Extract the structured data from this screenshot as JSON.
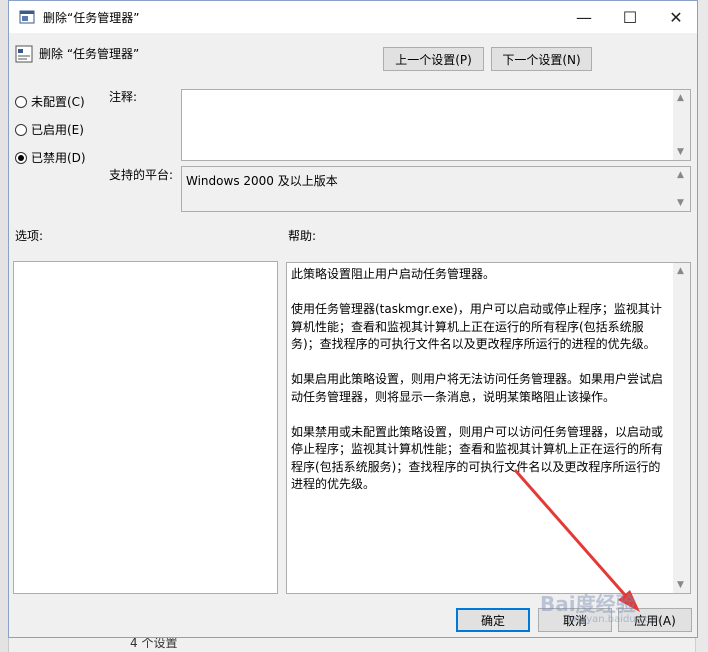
{
  "background": {
    "status_text": "4 个设置"
  },
  "window": {
    "title": "删除“任务管理器”",
    "controls": {
      "minimize": "—",
      "maximize": "☐",
      "close": "✕"
    }
  },
  "header": {
    "policy_name": "删除 “任务管理器”",
    "prev_button": "上一个设置(P)",
    "next_button": "下一个设置(N)"
  },
  "state": {
    "options": [
      {
        "label": "未配置(C)",
        "checked": false
      },
      {
        "label": "已启用(E)",
        "checked": false
      },
      {
        "label": "已禁用(D)",
        "checked": true
      }
    ]
  },
  "comment": {
    "label": "注释:",
    "value": ""
  },
  "platform": {
    "label": "支持的平台:",
    "value": "Windows 2000 及以上版本"
  },
  "options_pane": {
    "label": "选项:"
  },
  "help_pane": {
    "label": "帮助:",
    "text": "此策略设置阻止用户启动任务管理器。\n\n使用任务管理器(taskmgr.exe)，用户可以启动或停止程序；监视其计算机性能；查看和监视其计算机上正在运行的所有程序(包括系统服务)；查找程序的可执行文件名以及更改程序所运行的进程的优先级。\n\n如果启用此策略设置，则用户将无法访问任务管理器。如果用户尝试启动任务管理器，则将显示一条消息，说明某策略阻止该操作。\n\n如果禁用或未配置此策略设置，则用户可以访问任务管理器，以启动或停止程序；监视其计算机性能；查看和监视其计算机上正在运行的所有程序(包括系统服务)；查找程序的可执行文件名以及更改程序所运行的进程的优先级。"
  },
  "footer": {
    "ok": "确定",
    "cancel": "取消",
    "apply": "应用(A)"
  },
  "watermark": {
    "text": "Bai度经验",
    "sub": "jingyan.baidu.com"
  },
  "colors": {
    "accent": "#0078d7",
    "annotation_arrow": "#e53935"
  }
}
